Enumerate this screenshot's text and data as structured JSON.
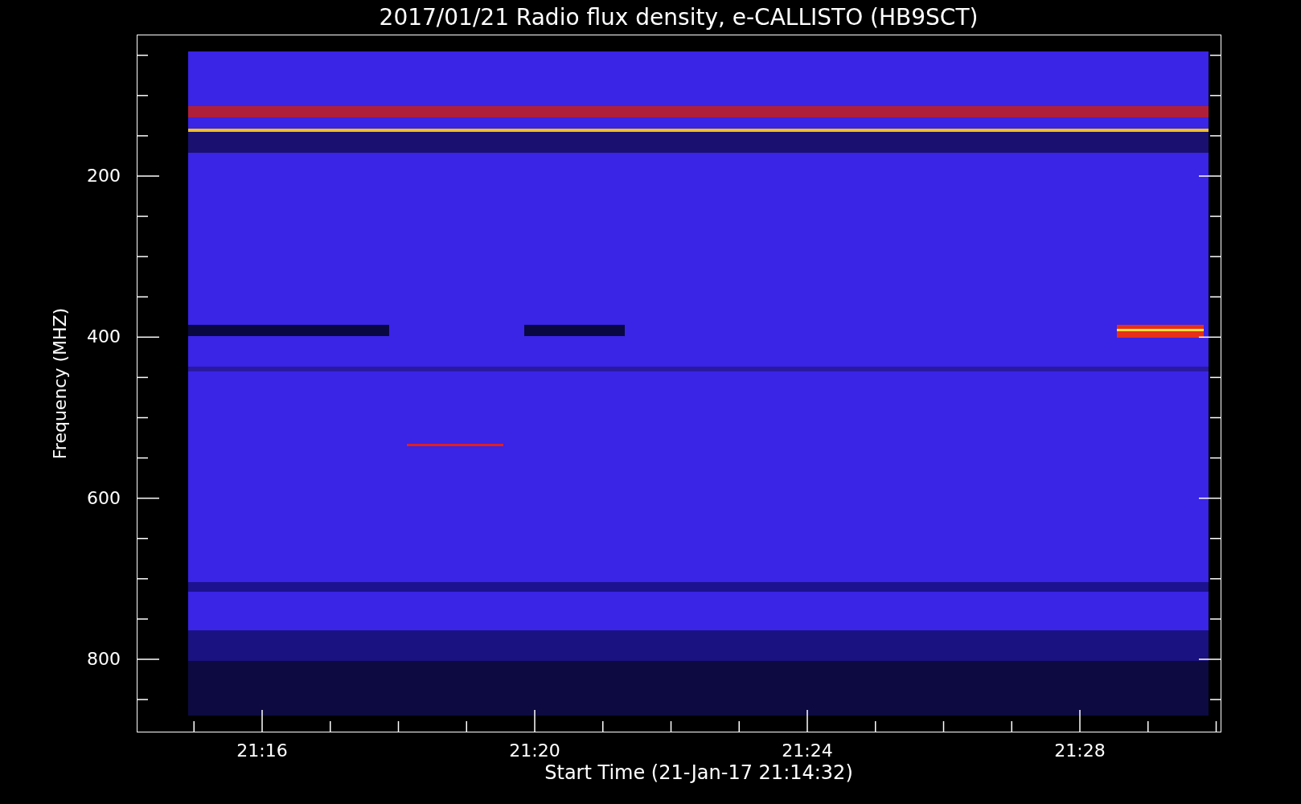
{
  "title": "2017/01/21  Radio flux density, e-CALLISTO (HB9SCT)",
  "y_axis": {
    "label": "Frequency (MHZ)",
    "ticks": [
      "200",
      "400",
      "600",
      "800"
    ]
  },
  "x_axis": {
    "label": "Start Time (21-Jan-17 21:14:32)",
    "ticks": [
      "21:16",
      "21:20",
      "21:24",
      "21:28"
    ]
  }
}
